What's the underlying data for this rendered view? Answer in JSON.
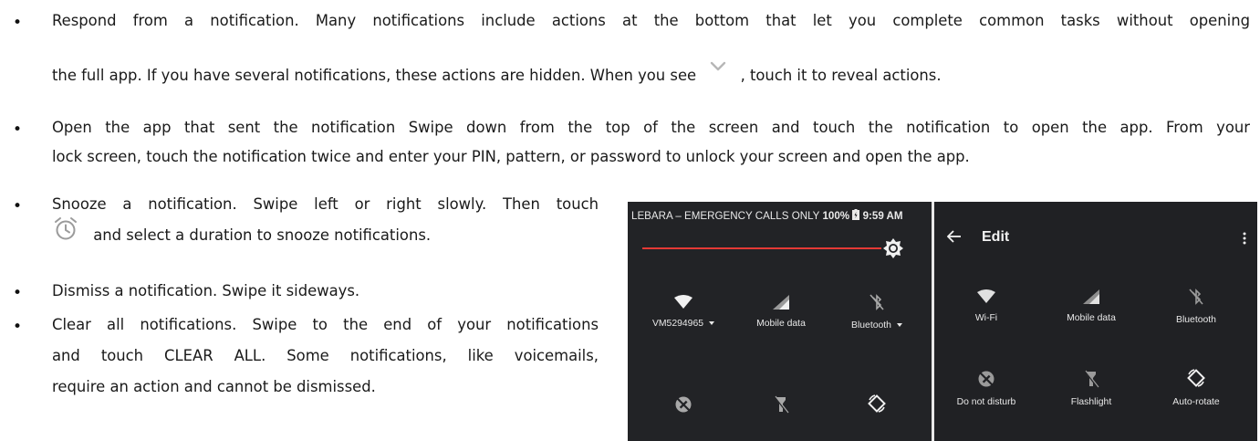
{
  "bullets": [
    {
      "lines": [
        "Respond from a notification. Many notifications include actions at the bottom that let you complete common tasks without opening",
        "the full app. If you have several notifications, these actions are hidden. When you see",
        ", touch it to reveal actions."
      ]
    },
    {
      "lines": [
        "Open the app that sent the notification Swipe down from the top of the screen and touch the notification to open the app. From your",
        "lock screen, touch the notification twice and enter your PIN, pattern, or password to unlock your screen and open the app."
      ]
    },
    {
      "lines": [
        "Snooze a notification. Swipe left or right slowly. Then touch",
        "and select a duration to snooze notifications."
      ]
    },
    {
      "lines": [
        "Dismiss a notification. Swipe it sideways."
      ]
    },
    {
      "lines": [
        "Clear all notifications. Swipe to the end of your notifications",
        "and touch CLEAR ALL. Some notifications, like voicemails,",
        "require an action and cannot be dismissed."
      ]
    }
  ],
  "bullet_symbol": "•",
  "phone": {
    "status_carrier": "LEBARA – EMERGENCY CALLS ONLY",
    "status_battery": "100%",
    "status_time": "9:59 AM",
    "left_tiles": [
      {
        "label": "VM5294965",
        "icon": "wifi-icon",
        "dropdown": true
      },
      {
        "label": "Mobile data",
        "icon": "mobile-data-icon",
        "dropdown": false
      },
      {
        "label": "Bluetooth",
        "icon": "bluetooth-off-icon",
        "dropdown": true
      },
      {
        "label": "",
        "icon": "do-not-disturb-icon",
        "dropdown": false
      },
      {
        "label": "",
        "icon": "flashlight-off-icon",
        "dropdown": false
      },
      {
        "label": "",
        "icon": "auto-rotate-icon",
        "dropdown": false
      }
    ],
    "edit_title": "Edit",
    "right_tiles": [
      {
        "label": "Wi-Fi",
        "icon": "wifi-icon"
      },
      {
        "label": "Mobile data",
        "icon": "mobile-data-icon"
      },
      {
        "label": "Bluetooth",
        "icon": "bluetooth-off-icon"
      },
      {
        "label": "Do not disturb",
        "icon": "do-not-disturb-icon"
      },
      {
        "label": "Flashlight",
        "icon": "flashlight-off-icon"
      },
      {
        "label": "Auto-rotate",
        "icon": "auto-rotate-icon"
      }
    ],
    "colors": {
      "background": "#222326",
      "text": "#e8e8e8",
      "accent": "#e53935"
    }
  }
}
